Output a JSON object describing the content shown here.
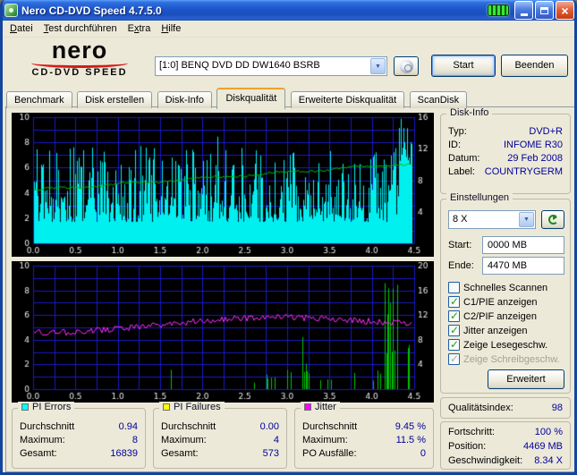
{
  "colors": {
    "value_text": "#000099",
    "bar_cyan": "#00EFEF",
    "bar_green": "#00C400",
    "jitter_magenta": "#FF2BFF",
    "speed_green": "#00B800",
    "grid_blue": "#1818C8",
    "chart_bg": "#000000"
  },
  "window": {
    "title": "Nero CD-DVD Speed 4.7.5.0"
  },
  "menu": {
    "items": [
      {
        "pre": "",
        "key": "D",
        "post": "atei"
      },
      {
        "pre": "",
        "key": "T",
        "post": "est durchführen"
      },
      {
        "pre": "E",
        "key": "x",
        "post": "tra"
      },
      {
        "pre": "",
        "key": "H",
        "post": "ilfe"
      }
    ]
  },
  "logo": {
    "brand": "nero",
    "product": "CD-DVD SPEED"
  },
  "toolbar": {
    "drive": "[1:0]   BENQ DVD DD DW1640 BSRB",
    "start_label": "Start",
    "quit_label": "Beenden"
  },
  "tabs": {
    "labels": [
      "Benchmark",
      "Disk erstellen",
      "Disk-Info",
      "Diskqualität",
      "Erweiterte Diskqualität",
      "ScanDisk"
    ],
    "active": "Diskqualität"
  },
  "disk_info": {
    "title": "Disk-Info",
    "rows": [
      {
        "label": "Typ:",
        "value": "DVD+R"
      },
      {
        "label": "ID:",
        "value": "INFOME R30"
      },
      {
        "label": "Datum:",
        "value": "29 Feb 2008"
      },
      {
        "label": "Label:",
        "value": "COUNTRYGERM"
      }
    ]
  },
  "settings": {
    "title": "Einstellungen",
    "speed": "8 X",
    "start_label": "Start:",
    "start_value": "0000 MB",
    "end_label": "Ende:",
    "end_value": "4470 MB",
    "checkboxes": [
      {
        "label": "Schnelles Scannen",
        "checked": false,
        "disabled": false
      },
      {
        "label": "C1/PIE anzeigen",
        "checked": true,
        "disabled": false
      },
      {
        "label": "C2/PIF anzeigen",
        "checked": true,
        "disabled": false
      },
      {
        "label": "Jitter anzeigen",
        "checked": true,
        "disabled": false
      },
      {
        "label": "Zeige Lesegeschw.",
        "checked": true,
        "disabled": false
      },
      {
        "label": "Zeige Schreibgeschw.",
        "checked": true,
        "disabled": true
      }
    ],
    "advanced_label": "Erweitert"
  },
  "quality": {
    "label": "Qualitätsindex:",
    "value": "98"
  },
  "progress": {
    "rows": [
      {
        "label": "Fortschritt:",
        "value": "100 %"
      },
      {
        "label": "Position:",
        "value": "4469 MB"
      },
      {
        "label": "Geschwindigkeit:",
        "value": "8.34 X"
      }
    ]
  },
  "stats": [
    {
      "title": "PI Errors",
      "color": "#00FFFF",
      "rows": [
        {
          "label": "Durchschnitt",
          "value": "0.94"
        },
        {
          "label": "Maximum:",
          "value": "8"
        },
        {
          "label": "Gesamt:",
          "value": "16839"
        }
      ]
    },
    {
      "title": "PI Failures",
      "color": "#FFFF00",
      "rows": [
        {
          "label": "Durchschnitt",
          "value": "0.00"
        },
        {
          "label": "Maximum:",
          "value": "4"
        },
        {
          "label": "Gesamt:",
          "value": "573"
        }
      ]
    },
    {
      "title": "Jitter",
      "color": "#FF00FF",
      "rows": [
        {
          "label": "Durchschnitt",
          "value": "9.45 %"
        },
        {
          "label": "Maximum:",
          "value": "11.5 %"
        },
        {
          "label": "PO Ausfälle:",
          "value": "0"
        }
      ]
    }
  ],
  "chart_data": [
    {
      "type": "bar",
      "name": "pi-errors-scan",
      "x_min": 0,
      "x_max": 4.5,
      "data_end": 4.47,
      "x_grid_step": 0.25,
      "x_tick_step": 0.5,
      "x_tick_labels": [
        "0.0",
        "0.5",
        "1.0",
        "1.5",
        "2.0",
        "2.5",
        "3.0",
        "3.5",
        "4.0",
        "4.5"
      ],
      "y_min": 0,
      "y_max": 10,
      "y_ticks": [
        0,
        2,
        4,
        6,
        8,
        10
      ],
      "right_ticks": [
        {
          "v": 4,
          "at": 2.5
        },
        {
          "v": 8,
          "at": 5
        },
        {
          "v": 12,
          "at": 7.5
        },
        {
          "v": 16,
          "at": 10
        }
      ],
      "bg": "#000000",
      "grid_color": "#1818C8",
      "bar_color": "#00EFEF",
      "seed": 20080229,
      "bars": {
        "mode": "dense",
        "base": 1.7,
        "span": 6.0,
        "pow": 1.9,
        "spike_p": 0.05,
        "spike_add": 2.4,
        "tail_from": 4.31,
        "tail_min": 6,
        "tail_max": 10
      },
      "lines": [
        {
          "name": "read-speed",
          "color": "#00B800",
          "from": 4.2,
          "to": 6.35,
          "noise": 0.09
        }
      ],
      "summary": {
        "pi_average": 0.94,
        "pi_maximum": 8,
        "pi_total": 16839,
        "end_speed_x": 8.34
      }
    },
    {
      "type": "bar",
      "name": "pi-failures-jitter-scan",
      "x_min": 0,
      "x_max": 4.5,
      "data_end": 4.47,
      "x_grid_step": 0.25,
      "x_tick_step": 0.5,
      "x_tick_labels": [
        "0.0",
        "0.5",
        "1.0",
        "1.5",
        "2.0",
        "2.5",
        "3.0",
        "3.5",
        "4.0",
        "4.5"
      ],
      "y_min": 0,
      "y_max": 10,
      "y_ticks": [
        0,
        2,
        4,
        6,
        8,
        10
      ],
      "right_ticks": [
        {
          "v": 4,
          "at": 2
        },
        {
          "v": 8,
          "at": 4
        },
        {
          "v": 12,
          "at": 6
        },
        {
          "v": 16,
          "at": 8
        },
        {
          "v": 20,
          "at": 10
        }
      ],
      "bg": "#000000",
      "grid_color": "#1818C8",
      "bar_color": "#00C400",
      "seed": 573,
      "bars": {
        "mode": "sparse",
        "p_low": 0.012,
        "p_high": 0.09,
        "high_from": 2.6,
        "h_min": 0.35,
        "h_max": 1.6,
        "clusters": [
          {
            "x": 3.22,
            "w": 0.1,
            "max": 4.3
          },
          {
            "x": 3.5,
            "w": 0.05,
            "max": 2.3
          },
          {
            "x": 4.22,
            "w": 0.16,
            "max": 8.8
          },
          {
            "x": 4.42,
            "w": 0.05,
            "max": 4.0
          }
        ]
      },
      "lines": [
        {
          "name": "jitter",
          "color": "#FF2BFF",
          "jitter_profile": true,
          "base": 4.55,
          "peak": 5.85,
          "peak_x": 3.0,
          "end": 5.3,
          "noise": 0.26
        }
      ],
      "summary": {
        "jitter_average_percent": 9.45,
        "jitter_maximum_percent": 11.5,
        "po_failures": 0,
        "pif_average": 0.0,
        "pif_maximum": 4,
        "pif_total": 573
      }
    }
  ]
}
